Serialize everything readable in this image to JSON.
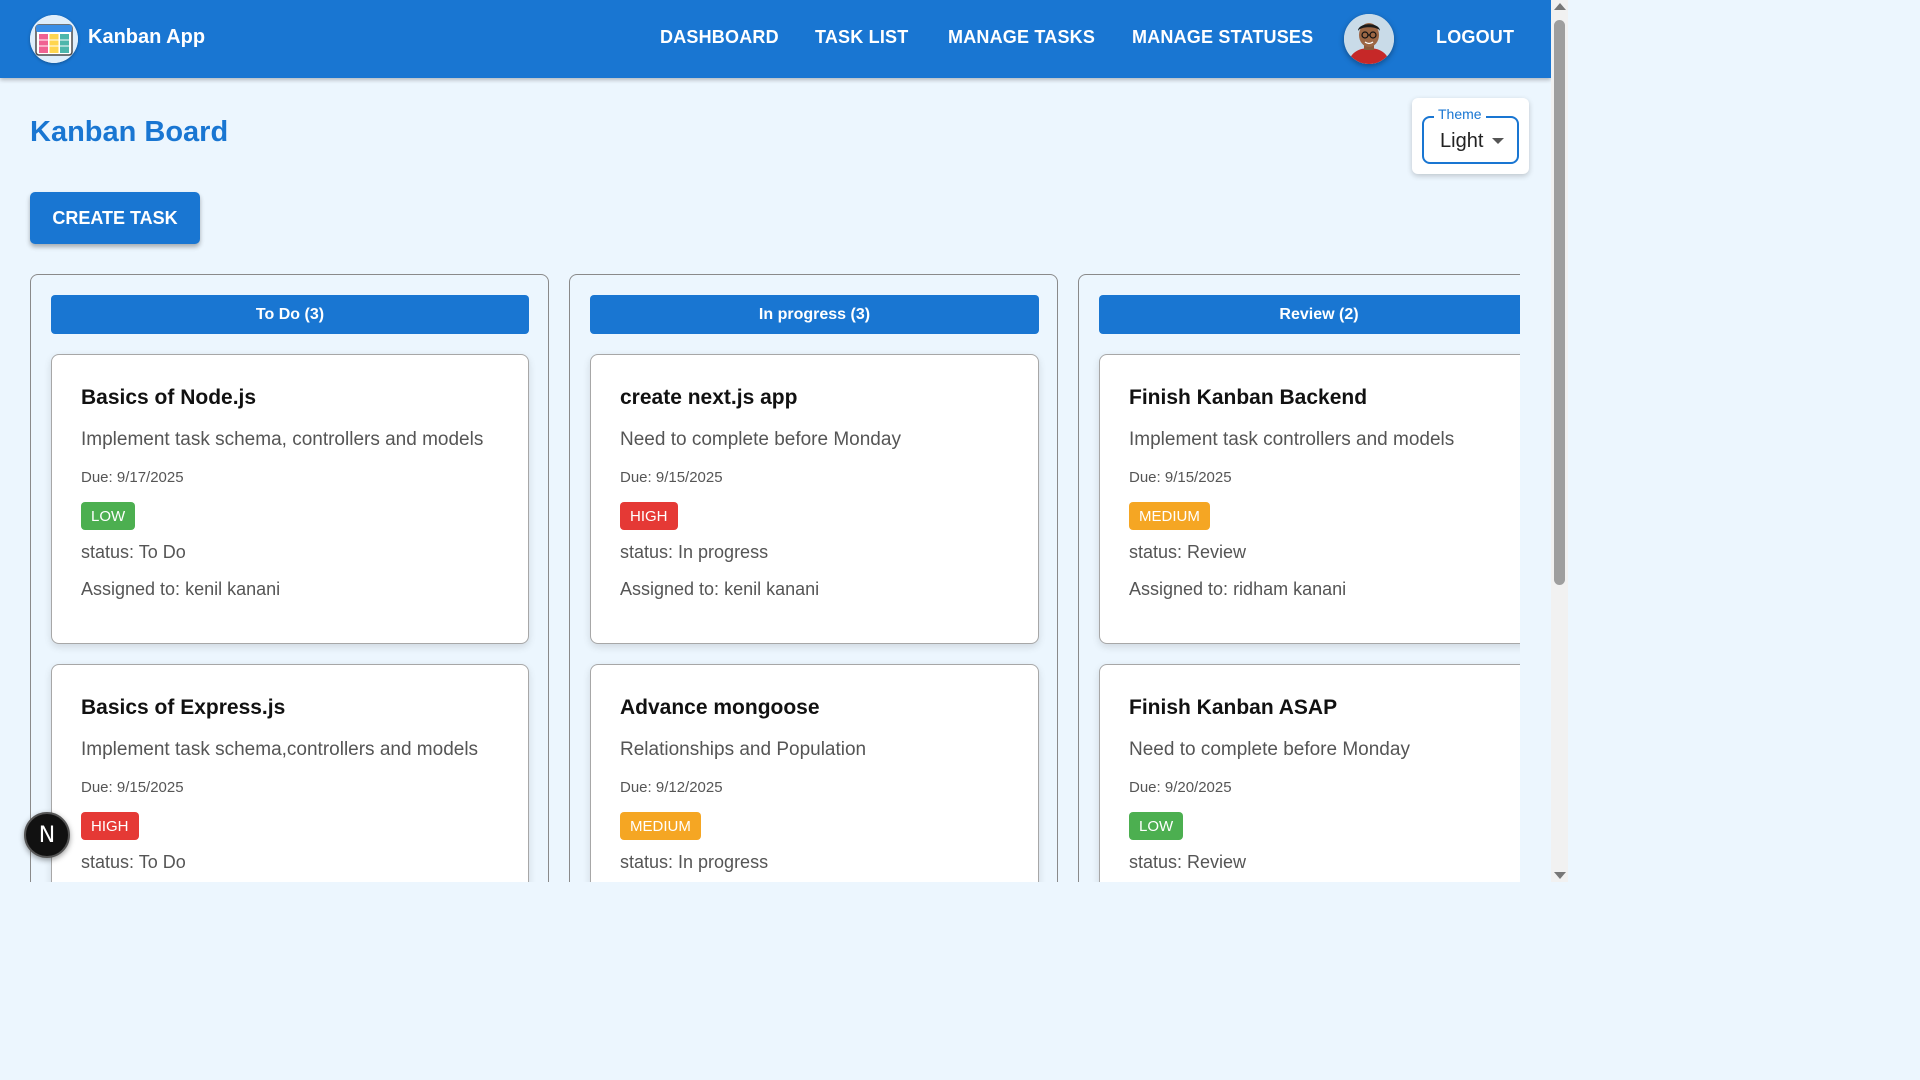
{
  "app": {
    "brand": "Kanban App"
  },
  "nav": [
    {
      "label": "DASHBOARD"
    },
    {
      "label": "TASK LIST"
    },
    {
      "label": "MANAGE TASKS"
    },
    {
      "label": "MANAGE STATUSES"
    }
  ],
  "logout_label": "LOGOUT",
  "page_title": "Kanban Board",
  "create_button": "CREATE TASK",
  "theme": {
    "legend": "Theme",
    "value": "Light"
  },
  "colors": {
    "primary": "#1976d2",
    "low": "#4caf50",
    "medium": "#f5a623",
    "high": "#e53935",
    "background": "#ecf6fe"
  },
  "columns": [
    {
      "header": "To Do (3)",
      "cards": [
        {
          "title": "Basics of Node.js",
          "description": "Implement task schema, controllers and models",
          "due": "Due: 9/17/2025",
          "priority": "LOW",
          "status": "status: To Do",
          "assignee": "Assigned to: kenil kanani"
        },
        {
          "title": "Basics of Express.js",
          "description": "Implement task schema,controllers and models",
          "due": "Due: 9/15/2025",
          "priority": "HIGH",
          "status": "status: To Do",
          "assignee": ""
        }
      ]
    },
    {
      "header": "In progress (3)",
      "cards": [
        {
          "title": "create next.js app",
          "description": "Need to complete before Monday",
          "due": "Due: 9/15/2025",
          "priority": "HIGH",
          "status": "status: In progress",
          "assignee": "Assigned to: kenil kanani"
        },
        {
          "title": "Advance mongoose",
          "description": "Relationships and Population",
          "due": "Due: 9/12/2025",
          "priority": "MEDIUM",
          "status": "status: In progress",
          "assignee": ""
        }
      ]
    },
    {
      "header": "Review (2)",
      "cards": [
        {
          "title": "Finish Kanban Backend",
          "description": "Implement task controllers and models",
          "due": "Due: 9/15/2025",
          "priority": "MEDIUM",
          "status": "status: Review",
          "assignee": "Assigned to: ridham kanani"
        },
        {
          "title": "Finish Kanban ASAP",
          "description": "Need to complete before Monday",
          "due": "Due: 9/20/2025",
          "priority": "LOW",
          "status": "status: Review",
          "assignee": ""
        }
      ]
    }
  ],
  "dev_badge": "N"
}
